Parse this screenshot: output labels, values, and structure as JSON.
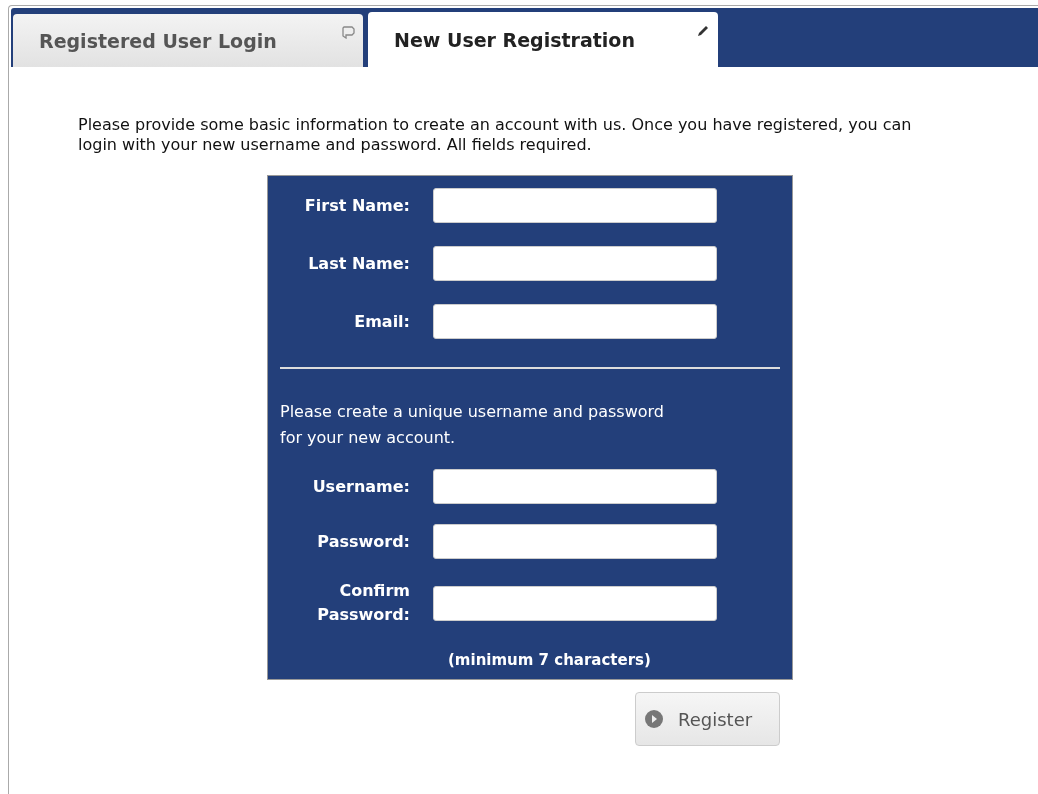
{
  "tabs": [
    {
      "label": "Registered User Login",
      "selected": false
    },
    {
      "label": "New User Registration",
      "selected": true
    }
  ],
  "intro": "Please provide some basic information to create an account with us. Once you have registered, you can login with your new username and password. All fields required.",
  "form": {
    "personal_fields": [
      {
        "label": "First Name:"
      },
      {
        "label": "Last Name:"
      },
      {
        "label": "Email:"
      }
    ],
    "account_prompt": "Please create a unique username and password for your new account.",
    "account_fields": [
      {
        "label": "Username:"
      },
      {
        "label": "Password:"
      },
      {
        "label": "Confirm Password:"
      }
    ],
    "note": "(minimum 7 characters)"
  },
  "button": {
    "label": "Register"
  }
}
